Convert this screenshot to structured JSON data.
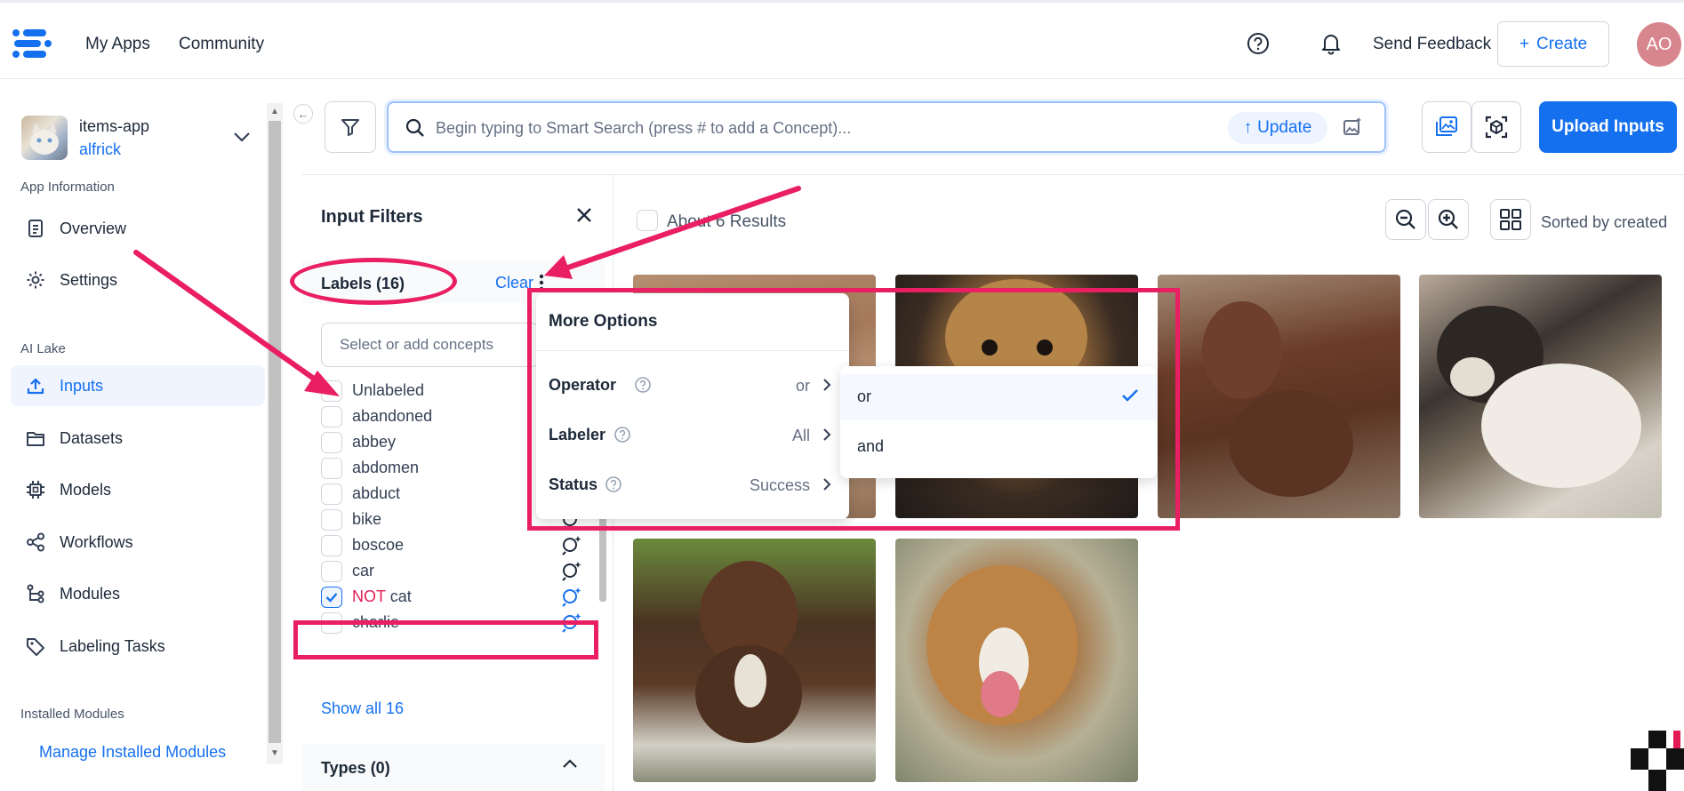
{
  "topbar": {
    "nav": [
      "My Apps",
      "Community"
    ],
    "send_feedback": "Send Feedback",
    "create_label": "Create",
    "avatar_initials": "AO"
  },
  "sidebar": {
    "app_name": "items-app",
    "app_user": "alfrick",
    "sections": {
      "app_information": "App Information",
      "ai_lake": "AI Lake",
      "installed_modules": "Installed Modules"
    },
    "items": [
      {
        "label": "Overview",
        "icon": "document-icon"
      },
      {
        "label": "Settings",
        "icon": "gear-icon"
      },
      {
        "label": "Inputs",
        "icon": "upload-icon",
        "active": true
      },
      {
        "label": "Datasets",
        "icon": "folder-icon"
      },
      {
        "label": "Models",
        "icon": "chip-icon"
      },
      {
        "label": "Workflows",
        "icon": "share-icon"
      },
      {
        "label": "Modules",
        "icon": "tree-icon"
      },
      {
        "label": "Labeling Tasks",
        "icon": "tag-icon"
      }
    ],
    "manage_modules": "Manage Installed Modules"
  },
  "search": {
    "placeholder": "Begin typing to Smart Search (press # to add a Concept)...",
    "update_label": "Update"
  },
  "upload_label": "Upload Inputs",
  "filters": {
    "title": "Input Filters",
    "labels_title": "Labels (16)",
    "clear": "Clear",
    "concept_placeholder": "Select or add concepts",
    "labels": [
      {
        "text": "Unlabeled",
        "checked": false
      },
      {
        "text": "abandoned",
        "checked": false
      },
      {
        "text": "abbey",
        "checked": false
      },
      {
        "text": "abdomen",
        "checked": false
      },
      {
        "text": "abduct",
        "checked": false
      },
      {
        "text": "bike",
        "checked": false
      },
      {
        "text": "boscoe",
        "checked": false
      },
      {
        "text": "car",
        "checked": false
      },
      {
        "text": "cat",
        "prefix": "NOT",
        "checked": true
      },
      {
        "text": "charlie",
        "checked": false
      }
    ],
    "show_all": "Show all 16",
    "types_title": "Types (0)"
  },
  "results": {
    "count_text": "About 6 Results",
    "sorted_text": "Sorted by created"
  },
  "more_options": {
    "title": "More Options",
    "rows": [
      {
        "label": "Operator",
        "value": "or"
      },
      {
        "label": "Labeler",
        "value": "All"
      },
      {
        "label": "Status",
        "value": "Success"
      }
    ],
    "operator_choices": [
      {
        "label": "or",
        "selected": true
      },
      {
        "label": "and",
        "selected": false
      }
    ]
  },
  "colors": {
    "accent": "#1570ef",
    "highlight": "#ea1e63",
    "active_bg": "#eff4ff"
  }
}
